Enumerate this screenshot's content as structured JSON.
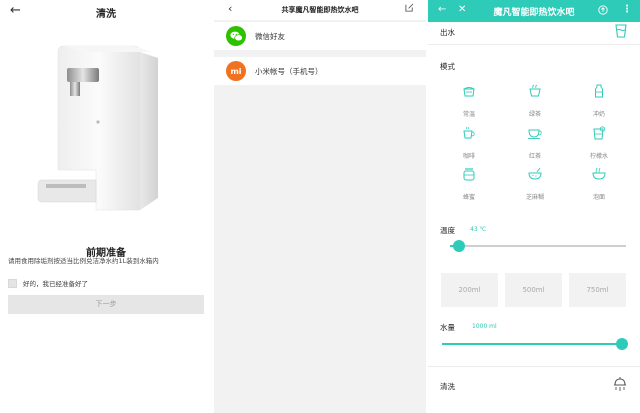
{
  "colors": {
    "accent": "#2ecbb8",
    "wechat": "#2dc100",
    "xiaomi": "#f0711f"
  },
  "panel1": {
    "title": "清洗",
    "heading": "前期准备",
    "description": "请用食用除垢剂按适当比例兑洁净水约1L装到水箱内",
    "checkbox_label": "好的，我已经准备好了",
    "next_button": "下一步"
  },
  "panel2": {
    "title": "共享魔凡智能即热饮水吧",
    "options": [
      {
        "label": "微信好友",
        "icon": "wechat-icon"
      },
      {
        "label": "小米帐号（手机号）",
        "icon": "xiaomi-icon",
        "icon_text": "mi"
      }
    ]
  },
  "panel3": {
    "title": "魔凡智能即热饮水吧",
    "water_out_label": "出水",
    "mode_label": "模式",
    "modes": [
      {
        "label": "常温",
        "icon": "room-temp-icon"
      },
      {
        "label": "绿茶",
        "icon": "green-tea-icon"
      },
      {
        "label": "冲奶",
        "icon": "milk-bottle-icon"
      },
      {
        "label": "咖啡",
        "icon": "coffee-icon"
      },
      {
        "label": "红茶",
        "icon": "black-tea-icon"
      },
      {
        "label": "柠檬水",
        "icon": "lemon-water-icon"
      },
      {
        "label": "蜂蜜",
        "icon": "honey-icon"
      },
      {
        "label": "芝麻糊",
        "icon": "sesame-paste-icon"
      },
      {
        "label": "泡面",
        "icon": "instant-noodle-icon"
      }
    ],
    "temperature": {
      "label": "温度",
      "value_text": "43 ℃",
      "level": 0.05
    },
    "volumes": [
      "200ml",
      "500ml",
      "750ml"
    ],
    "water_amount": {
      "label": "水量",
      "value_text": "1000 ml",
      "level": 1.0
    },
    "clean_label": "清洗"
  }
}
